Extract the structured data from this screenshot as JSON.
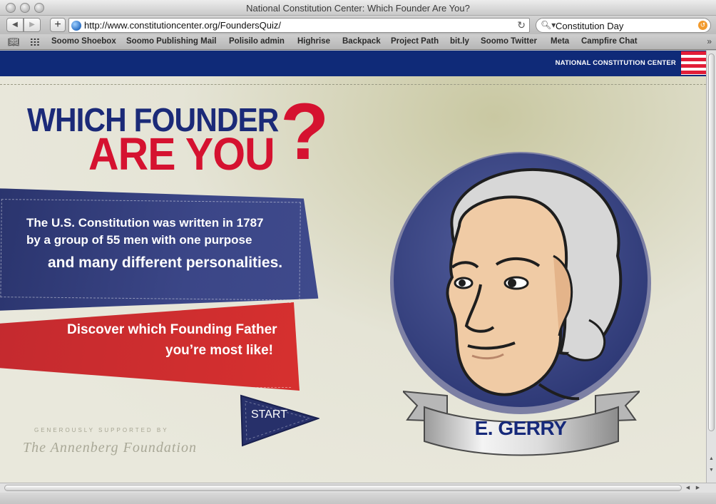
{
  "window": {
    "title": "National Constitution Center: Which Founder Are You?"
  },
  "toolbar": {
    "back_icon": "back-arrow-icon",
    "forward_icon": "forward-arrow-icon",
    "add_label": "+",
    "url": "http://www.constitutioncenter.org/FoundersQuiz/",
    "search_value": "Constitution Day"
  },
  "bookmarks": {
    "items": [
      "Soomo Shoebox",
      "Soomo Publishing Mail",
      "Polisilo admin",
      "Highrise",
      "Backpack",
      "Project Path",
      "bit.ly",
      "Soomo Twitter",
      "Meta",
      "Campfire Chat"
    ]
  },
  "site": {
    "brand": "NATIONAL CONSTITUTION CENTER",
    "colors": {
      "navy": "#0f2a78",
      "red": "#d51230"
    }
  },
  "hero": {
    "headline_line1": "WHICH FOUNDER",
    "headline_line2": "ARE YOU",
    "question_mark": "?",
    "intro_line1": "The U.S. Constitution was written in 1787",
    "intro_line2": "by a group of 55 men with one purpose",
    "intro_line3": "and many different personalities.",
    "cta_line1": "Discover which Founding Father",
    "cta_line2": "you’re most like!",
    "start_label": "START",
    "supported_by": "GENEROUSLY SUPPORTED BY",
    "sponsor": "The Annenberg Foundation"
  },
  "founder": {
    "name": "E. GERRY"
  }
}
